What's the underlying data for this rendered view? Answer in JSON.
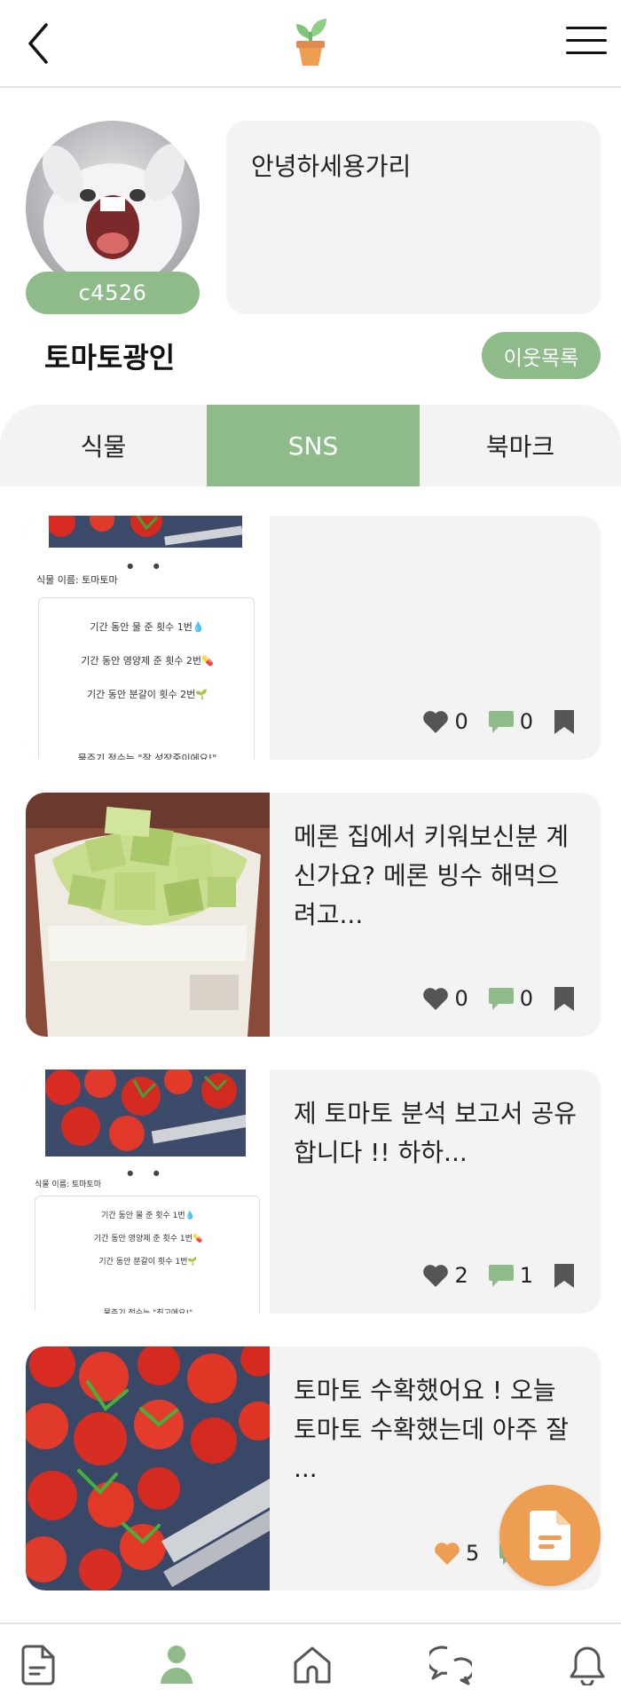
{
  "header": {
    "back_icon": "chevron-left-icon",
    "logo_icon": "potted-sprout-icon",
    "menu_icon": "hamburger-menu-icon"
  },
  "profile": {
    "user_id": "c4526",
    "bio": "안녕하세용가리",
    "nickname": "토마토광인",
    "neighbors_label": "이웃목록"
  },
  "tabs": [
    {
      "label": "식물",
      "active": false
    },
    {
      "label": "SNS",
      "active": true
    },
    {
      "label": "북마크",
      "active": false
    }
  ],
  "report_thumb": {
    "plant_name": "식물 이름: 토마토마",
    "line1": "기간 동안 물 준 횟수 1번💧",
    "line2": "기간 동안 영양제 준 횟수 2번💊",
    "line3": "기간 동안 분갈이 횟수 2번🌱",
    "line4": "물주기 점수는 \"잘 성장중이에요!\""
  },
  "report_thumb2": {
    "plant_name": "식물 이름: 토마토마",
    "line1": "기간 동안 물 준 횟수 1번💧",
    "line2": "기간 동안 영양제 준 횟수 1번💊",
    "line3": "기간 동안 분갈이 횟수 1번🌱",
    "line4": "물주기 점수는 \"최고에요!\""
  },
  "posts": [
    {
      "text": "",
      "likes": "0",
      "comments": "0"
    },
    {
      "text": "메론 집에서 키워보신분 계신가요? 메론 빙수 해먹으려고...",
      "likes": "0",
      "comments": "0"
    },
    {
      "text": "제 토마토  분석 보고서  공유합니다 !!  하하...",
      "likes": "2",
      "comments": "1"
    },
    {
      "text": "토마토 수확했어요 ! 오늘 토마토 수확했는데 아주 잘 ...",
      "likes": "5",
      "comments": ""
    }
  ],
  "colors": {
    "accent_green": "#8fba8a",
    "fab_orange": "#ee9e52",
    "liked_heart": "#ee9e52",
    "icon_gray": "#555555",
    "comment_green": "#8fba8a"
  },
  "bottom_nav": [
    {
      "icon": "document-icon",
      "active": false
    },
    {
      "icon": "person-icon",
      "active": true
    },
    {
      "icon": "home-icon",
      "active": false
    },
    {
      "icon": "chat-icon",
      "active": false
    },
    {
      "icon": "bell-icon",
      "active": false
    }
  ]
}
